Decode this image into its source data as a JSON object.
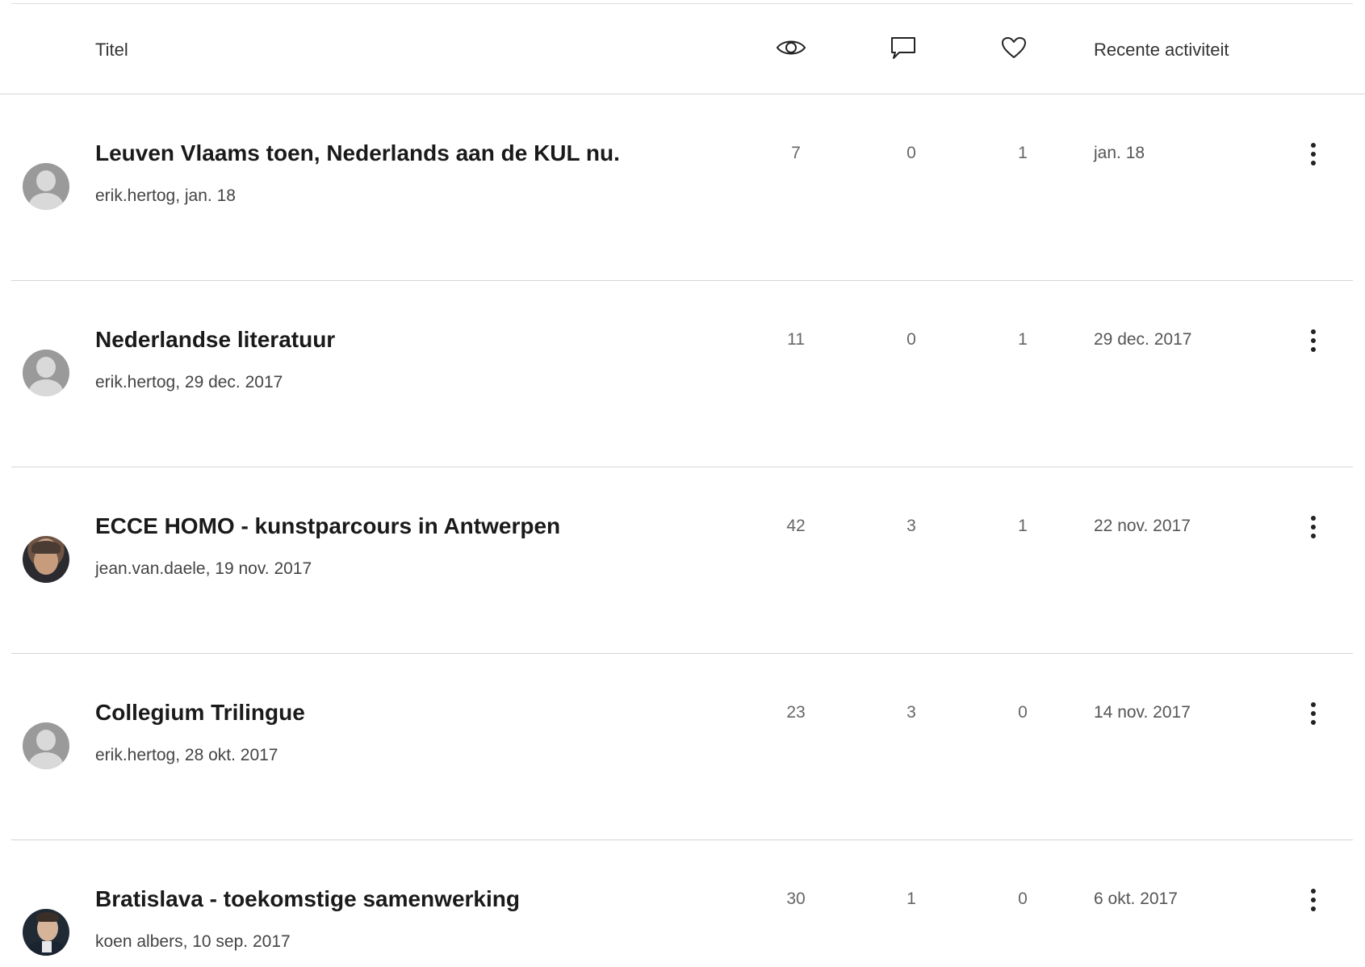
{
  "header": {
    "title_label": "Titel",
    "views_icon": "eye-icon",
    "replies_icon": "speech-bubble-icon",
    "likes_icon": "heart-icon",
    "activity_label": "Recente activiteit"
  },
  "topics": [
    {
      "title": "Leuven Vlaams toen, Nederlands aan de KUL nu.",
      "meta": "erik.hertog, jan. 18",
      "avatar": "default-avatar",
      "views": "7",
      "replies": "0",
      "likes": "1",
      "activity": "jan. 18"
    },
    {
      "title": "Nederlandse literatuur",
      "meta": "erik.hertog, 29 dec. 2017",
      "avatar": "default-avatar",
      "views": "11",
      "replies": "0",
      "likes": "1",
      "activity": "29 dec. 2017"
    },
    {
      "title": "ECCE HOMO - kunstparcours in Antwerpen",
      "meta": "jean.van.daele, 19 nov. 2017",
      "avatar": "photo-avatar",
      "views": "42",
      "replies": "3",
      "likes": "1",
      "activity": "22 nov. 2017"
    },
    {
      "title": "Collegium Trilingue",
      "meta": "erik.hertog, 28 okt. 2017",
      "avatar": "default-avatar",
      "views": "23",
      "replies": "3",
      "likes": "0",
      "activity": "14 nov. 2017"
    },
    {
      "title": "Bratislava - toekomstige samenwerking",
      "meta": "koen albers, 10 sep. 2017",
      "avatar": "photo-avatar",
      "views": "30",
      "replies": "1",
      "likes": "0",
      "activity": "6 okt. 2017"
    }
  ],
  "more_icon": "vertical-ellipsis-icon"
}
